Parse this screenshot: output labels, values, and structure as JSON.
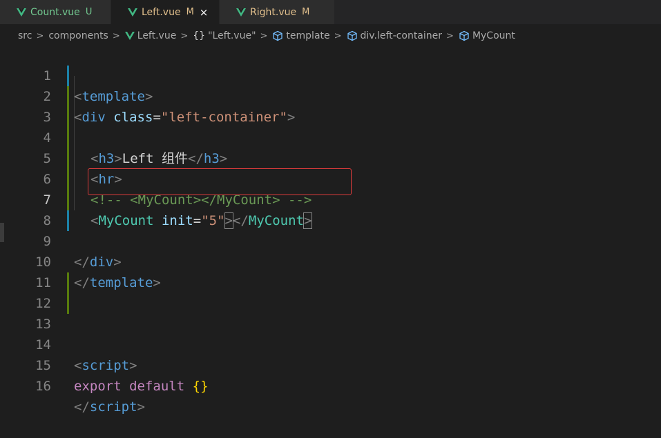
{
  "tabs": [
    {
      "label": "Count.vue",
      "status": "U",
      "status_color": "#73c991",
      "label_color": "#73c991",
      "active": false
    },
    {
      "label": "Left.vue",
      "status": "M",
      "status_color": "#e2c08d",
      "label_color": "#e2c08d",
      "active": true,
      "close": "×"
    },
    {
      "label": "Right.vue",
      "status": "M",
      "status_color": "#e2c08d",
      "label_color": "#e2c08d",
      "active": false
    }
  ],
  "breadcrumb": {
    "items": [
      "src",
      "components",
      "Left.vue",
      "\"Left.vue\"",
      "template",
      "div.left-container",
      "MyCount"
    ],
    "separator": ">",
    "braces_icon": "{}"
  },
  "editor": {
    "line_numbers": [
      "1",
      "2",
      "3",
      "4",
      "5",
      "6",
      "7",
      "8",
      "9",
      "10",
      "11",
      "12",
      "13",
      "14",
      "15",
      "16"
    ],
    "current_line": "7",
    "lines": {
      "l1": {
        "open": "<",
        "tag": "template",
        "close": ">"
      },
      "l2": {
        "open": "<",
        "tag": "div",
        "space": " ",
        "attr": "class",
        "eq": "=",
        "value": "\"left-container\"",
        "close": ">"
      },
      "l4": {
        "open": "<",
        "tag": "h3",
        "close": ">",
        "text": "Left 组件",
        "eopen": "</",
        "etag": "h3",
        "eclose": ">"
      },
      "l5": {
        "open": "<",
        "tag": "hr",
        "close": ">"
      },
      "l6": {
        "comment": "<!-- <MyCount></MyCount> -->"
      },
      "l7": {
        "open": "<",
        "tag": "MyCount",
        "space": " ",
        "attr": "init",
        "eq": "=",
        "value": "\"5\"",
        "close": ">",
        "eopen": "</",
        "etag": "MyCount",
        "eclose": ">"
      },
      "l9": {
        "open": "</",
        "tag": "div",
        "close": ">"
      },
      "l10": {
        "open": "</",
        "tag": "template",
        "close": ">"
      },
      "l14": {
        "open": "<",
        "tag": "script",
        "close": ">"
      },
      "l15": {
        "kw1": "export",
        "kw2": "default",
        "brace": "{}"
      },
      "l16": {
        "open": "</",
        "tag": "script",
        "close": ">"
      }
    }
  },
  "colors": {
    "added_marker": "#587c0c",
    "modified_marker": "#1b81a8",
    "highlight_box": "#e03c3c",
    "vue_icon": "#41b883"
  }
}
